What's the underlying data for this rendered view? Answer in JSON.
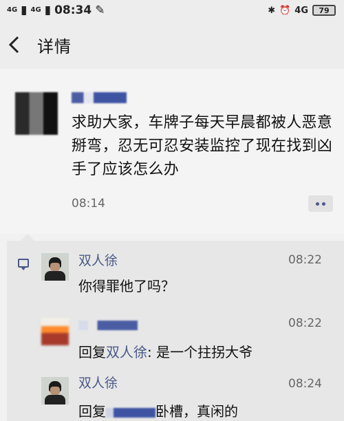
{
  "status_bar": {
    "network_1": "4G",
    "network_2": "4G",
    "time": "08:34",
    "network_3": "4G",
    "battery": "79"
  },
  "nav": {
    "back_icon": "chevron-left-icon",
    "title": "详情"
  },
  "post": {
    "text": "求助大家，车牌子每天早晨都被人恶意掰弯，忍无可忍安装监控了现在找到凶手了应该怎么办",
    "time": "08:14"
  },
  "comments": [
    {
      "name": "双人徐",
      "time": "08:22",
      "text": "你得罪他了吗？"
    },
    {
      "name": "",
      "time": "08:22",
      "reply_prefix": "回复",
      "reply_to": "双人徐",
      "text": ": 是一个拄拐大爷"
    },
    {
      "name": "双人徐",
      "time": "08:24",
      "reply_prefix": "回复",
      "text": "卧槽，真闲的"
    }
  ],
  "colors": {
    "link_blue": "#4a5a88",
    "background": "#f1f1f1",
    "comment_bg": "#e7e7e7"
  }
}
